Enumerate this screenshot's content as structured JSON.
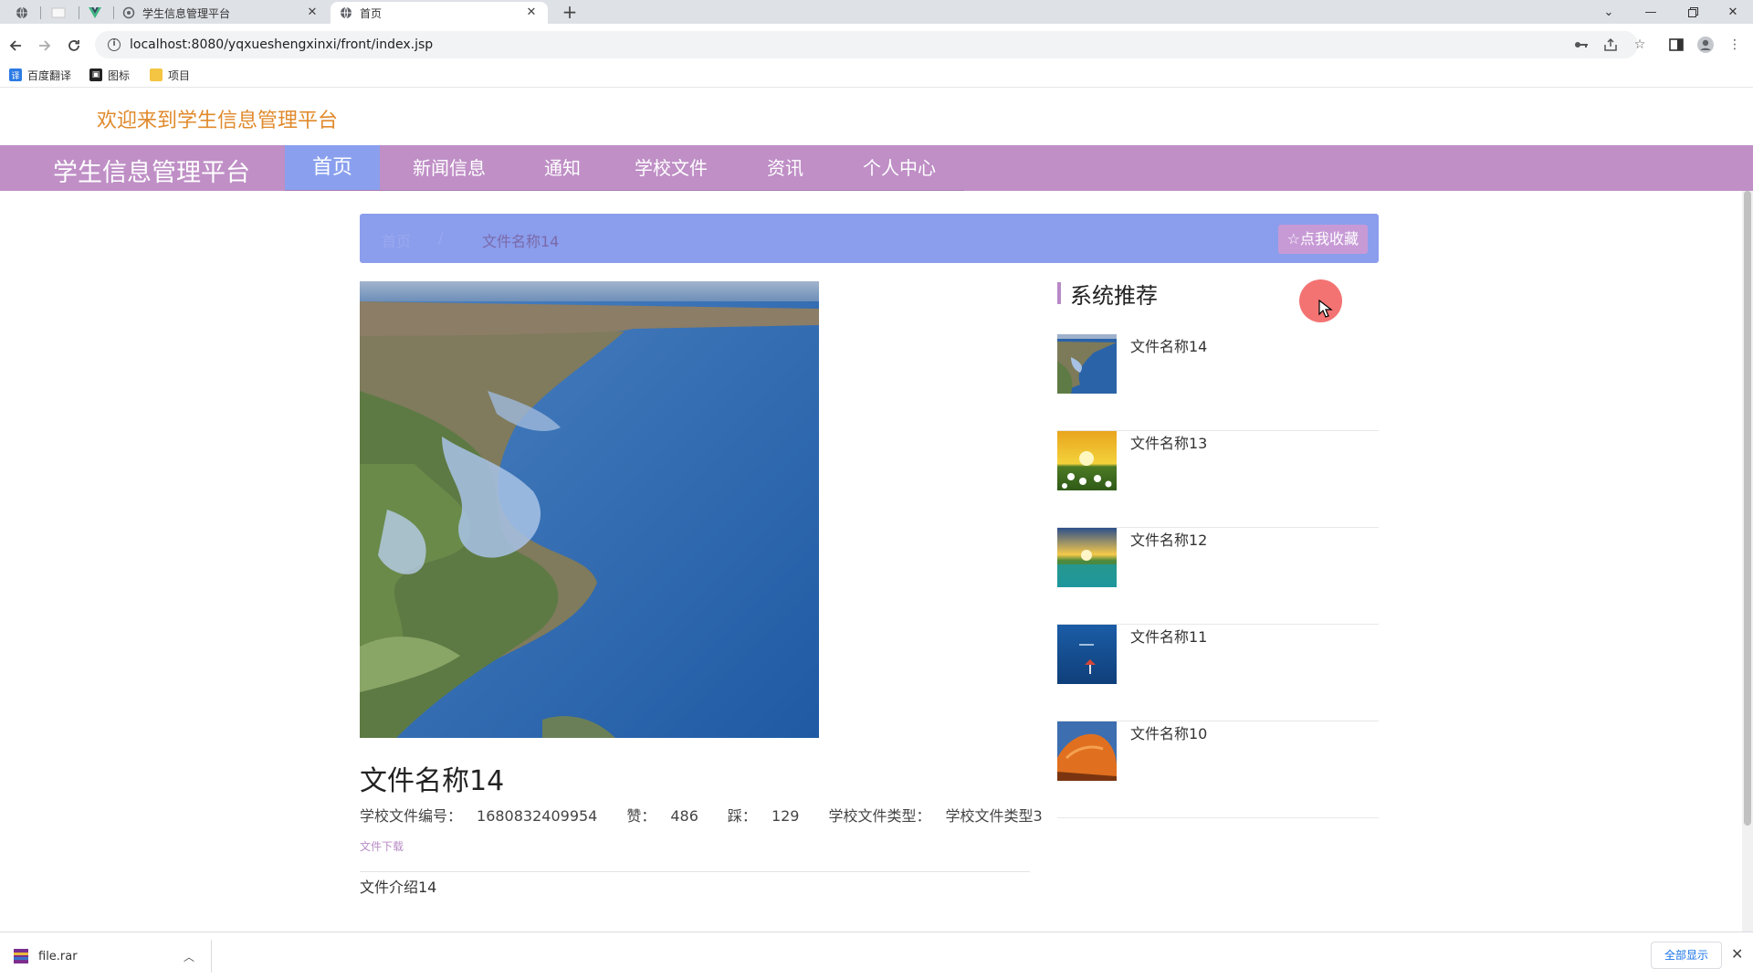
{
  "browser": {
    "tabs": [
      {
        "title": "学生信息管理平台",
        "active": false
      },
      {
        "title": "首页",
        "active": true
      }
    ],
    "url": "localhost:8080/yqxueshengxinxi/front/index.jsp",
    "bookmarks": [
      {
        "label": "百度翻译",
        "icon": "translate-icon",
        "color": "#2c7be5"
      },
      {
        "label": "图标",
        "icon": "image-icon",
        "color": "#222222"
      },
      {
        "label": "项目",
        "icon": "folder-icon",
        "color": "#f4c542"
      }
    ]
  },
  "site": {
    "welcome": "欢迎来到学生信息管理平台",
    "brand": "学生信息管理平台",
    "nav": [
      "首页",
      "新闻信息",
      "通知",
      "学校文件",
      "资讯",
      "个人中心"
    ],
    "nav_active": "首页",
    "colors": {
      "accent": "#bf8fc6",
      "active_nav": "#8aa0ee",
      "welcome": "#e08a2c",
      "breadcrumb_bg": "#8b9ded"
    }
  },
  "breadcrumb": {
    "home": "首页",
    "separator": "/",
    "current": "文件名称14"
  },
  "favorite_button": {
    "icon": "star-icon",
    "label": "点我收藏"
  },
  "document": {
    "title": "文件名称14",
    "meta": {
      "number_label": "学校文件编号：",
      "number": "1680832409954",
      "like_label": "赞：",
      "likes": "486",
      "dislike_label": "踩：",
      "dislikes": "129",
      "type_label": "学校文件类型：",
      "type": "学校文件类型3"
    },
    "download_label": "文件下载",
    "description": "文件介绍14"
  },
  "recommend": {
    "title": "系统推荐",
    "items": [
      {
        "name": "文件名称14",
        "thumb": "coastline"
      },
      {
        "name": "文件名称13",
        "thumb": "flowers-sunset"
      },
      {
        "name": "文件名称12",
        "thumb": "sunset-lake"
      },
      {
        "name": "文件名称11",
        "thumb": "sea-umbrella"
      },
      {
        "name": "文件名称10",
        "thumb": "orange-rock"
      }
    ]
  },
  "download_shelf": {
    "file": "file.rar",
    "show_all": "全部显示"
  }
}
